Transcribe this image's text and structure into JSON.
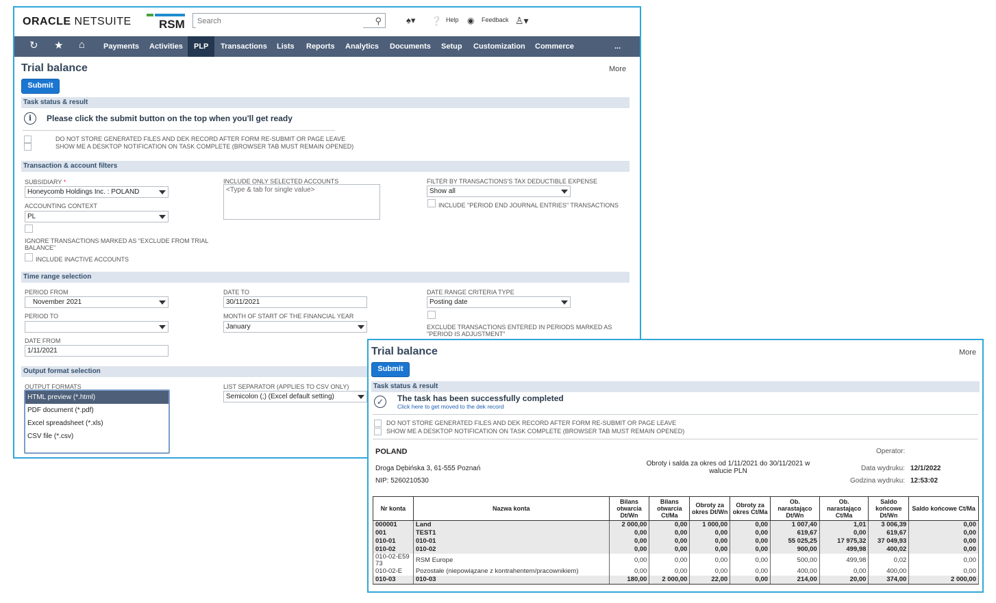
{
  "header": {
    "brand_oracle": "ORACLE",
    "brand_netsuite": "NETSUITE",
    "brand_rsm": "RSM",
    "search_placeholder": "Search",
    "help": "Help",
    "feedback": "Feedback"
  },
  "nav": {
    "items": [
      "Payments",
      "Activities",
      "PLP",
      "Transactions",
      "Lists",
      "Reports",
      "Analytics",
      "Documents",
      "Setup",
      "Customization",
      "Commerce",
      "..."
    ],
    "active": "PLP"
  },
  "form": {
    "title": "Trial balance",
    "more": "More",
    "submit": "Submit",
    "task_section": "Task status & result",
    "task_message": "Please click the submit button on the top when you'll get ready",
    "opt_no_store": "DO NOT STORE GENERATED FILES AND DEK RECORD AFTER FORM RE-SUBMIT OR PAGE LEAVE",
    "opt_notify": "SHOW ME A DESKTOP NOTIFICATION ON TASK COMPLETE (BROWSER TAB MUST REMAIN OPENED)",
    "filters_section": "Transaction & account filters",
    "subsidiary_label": "SUBSIDIARY",
    "subsidiary_required": "*",
    "subsidiary_value": "Honeycomb Holdings Inc. : POLAND",
    "accounting_context_label": "ACCOUNTING CONTEXT",
    "accounting_context_value": "PL",
    "ignore_excluded_label": "IGNORE TRANSACTIONS MARKED AS \"EXCLUDE FROM TRIAL BALANCE\"",
    "include_inactive_label": "INCLUDE INACTIVE ACCOUNTS",
    "include_selected_label": "INCLUDE ONLY SELECTED ACCOUNTS",
    "include_selected_placeholder": "<Type & tab for single value>",
    "filter_tax_label": "FILTER BY TRANSACTIONS'S TAX DEDUCTIBLE EXPENSE",
    "filter_tax_value": "Show all",
    "include_period_end_label": "INCLUDE \"PERIOD END JOURNAL ENTRIES\" TRANSACTIONS",
    "time_section": "Time range selection",
    "period_from_label": "PERIOD FROM",
    "period_from_value": "November 2021",
    "period_to_label": "PERIOD TO",
    "period_to_value": "",
    "date_from_label": "DATE FROM",
    "date_from_value": "1/11/2021",
    "date_to_label": "DATE TO",
    "date_to_value": "30/11/2021",
    "month_start_label": "MONTH OF START OF THE FINANCIAL YEAR",
    "month_start_value": "January",
    "date_criteria_label": "DATE RANGE CRITERIA TYPE",
    "date_criteria_value": "Posting date",
    "exclude_adjustment_label": "EXCLUDE TRANSACTIONS ENTERED IN PERIODS MARKED AS \"PERIOD IS ADJUSTMENT\"",
    "output_section": "Output format selection",
    "output_formats_label": "OUTPUT FORMATS",
    "output_formats": [
      "HTML preview (*.html)",
      "PDF document (*.pdf)",
      "Excel spreadsheet (*.xls)",
      "CSV file (*.csv)"
    ],
    "list_separator_label": "LIST SEPARATOR (APPLIES TO CSV ONLY)",
    "list_separator_value": "Semicolon (;) (Excel default setting)"
  },
  "result": {
    "title": "Trial balance",
    "more": "More",
    "submit": "Submit",
    "task_section": "Task status & result",
    "success_message": "The task has been successfully completed",
    "success_link": "Click here to get moved to the dek record",
    "opt_no_store": "DO NOT STORE GENERATED FILES AND DEK RECORD AFTER FORM RE-SUBMIT OR PAGE LEAVE",
    "opt_notify": "SHOW ME A DESKTOP NOTIFICATION ON TASK COMPLETE (BROWSER TAB MUST REMAIN OPENED)"
  },
  "report": {
    "company": "POLAND",
    "address": "Droga Dębińska 3, 61-555 Poznań",
    "nip": "NIP: 5260210530",
    "period_title": "Obroty i salda za okres od 1/11/2021 do 30/11/2021 w walucie PLN",
    "operator_label": "Operator:",
    "operator_value": "",
    "print_date_label": "Data wydruku:",
    "print_date_value": "12/1/2022",
    "print_time_label": "Godzina wydruku:",
    "print_time_value": "12:53:02",
    "columns": [
      "Nr konta",
      "Nazwa konta",
      "Bilans otwarcia Dt/Wn",
      "Bilans otwarcia Ct/Ma",
      "Obroty za okres Dt/Wn",
      "Obroty za okres Ct/Ma",
      "Ob. narastająco Dt/Wn",
      "Ob. narastająco Ct/Ma",
      "Saldo końcowe Dt/Wn",
      "Saldo końcowe Ct/Ma"
    ],
    "rows": [
      {
        "bold": true,
        "cells": [
          "000001",
          "Land",
          "2 000,00",
          "0,00",
          "1 000,00",
          "0,00",
          "1 007,40",
          "1,01",
          "3 006,39",
          "0,00"
        ]
      },
      {
        "bold": true,
        "cells": [
          "001",
          "TEST1",
          "0,00",
          "0,00",
          "0,00",
          "0,00",
          "619,67",
          "0,00",
          "619,67",
          "0,00"
        ]
      },
      {
        "bold": true,
        "cells": [
          "010-01",
          "010-01",
          "0,00",
          "0,00",
          "0,00",
          "0,00",
          "55 025,25",
          "17 975,32",
          "37 049,93",
          "0,00"
        ]
      },
      {
        "bold": true,
        "cells": [
          "010-02",
          "010-02",
          "0,00",
          "0,00",
          "0,00",
          "0,00",
          "900,00",
          "499,98",
          "400,02",
          "0,00"
        ]
      },
      {
        "bold": false,
        "cells": [
          "010-02-E5973",
          "RSM Europe",
          "0,00",
          "0,00",
          "0,00",
          "0,00",
          "500,00",
          "499,98",
          "0,02",
          "0,00"
        ]
      },
      {
        "bold": false,
        "cells": [
          "010-02-E",
          "Pozostałe (niepowiązane z kontrahentem/pracownikiem)",
          "0,00",
          "0,00",
          "0,00",
          "0,00",
          "400,00",
          "0,00",
          "400,00",
          "0,00"
        ]
      },
      {
        "bold": true,
        "cells": [
          "010-03",
          "010-03",
          "180,00",
          "2 000,00",
          "22,00",
          "0,00",
          "214,00",
          "20,00",
          "374,00",
          "2 000,00"
        ]
      }
    ]
  }
}
